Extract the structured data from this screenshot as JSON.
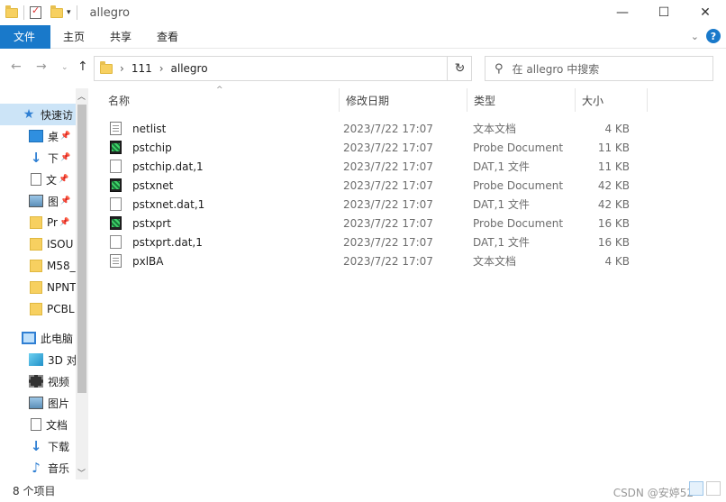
{
  "window": {
    "title": "allegro",
    "controls": {
      "minimize": "—",
      "maximize": "☐",
      "close": "✕"
    }
  },
  "ribbon": {
    "tabs": [
      "文件",
      "主页",
      "共享",
      "查看"
    ],
    "help": "?"
  },
  "address": {
    "crumbs": [
      "111",
      "allegro"
    ],
    "search_placeholder": "在 allegro 中搜索"
  },
  "sidebar": {
    "items": [
      {
        "label": "快速访",
        "icon": "star-icon",
        "pinned": false,
        "selected": true
      },
      {
        "label": "桌",
        "icon": "desktop-icon",
        "pinned": true
      },
      {
        "label": "下",
        "icon": "download-icon",
        "pinned": true
      },
      {
        "label": "文",
        "icon": "document-icon",
        "pinned": true
      },
      {
        "label": "图",
        "icon": "picture-icon",
        "pinned": true
      },
      {
        "label": "Pr",
        "icon": "folder-icon",
        "pinned": true
      },
      {
        "label": "ISOU",
        "icon": "folder-icon",
        "pinned": false
      },
      {
        "label": "M58_",
        "icon": "folder-icon",
        "pinned": false
      },
      {
        "label": "NPNT",
        "icon": "folder-icon",
        "pinned": false
      },
      {
        "label": "PCBL",
        "icon": "folder-icon",
        "pinned": false
      },
      {
        "label": "此电脑",
        "icon": "pc-icon",
        "pinned": false
      },
      {
        "label": "3D 对",
        "icon": "3d-objects-icon",
        "pinned": false
      },
      {
        "label": "视频",
        "icon": "video-icon",
        "pinned": false
      },
      {
        "label": "图片",
        "icon": "picture-icon",
        "pinned": false
      },
      {
        "label": "文档",
        "icon": "document-icon",
        "pinned": false
      },
      {
        "label": "下载",
        "icon": "download-icon",
        "pinned": false
      },
      {
        "label": "音乐",
        "icon": "music-icon",
        "pinned": false
      }
    ]
  },
  "columns": {
    "name": "名称",
    "date": "修改日期",
    "type": "类型",
    "size": "大小"
  },
  "files": [
    {
      "name": "netlist",
      "date": "2023/7/22 17:07",
      "type": "文本文档",
      "size": "4 KB",
      "icon": "text-file-icon"
    },
    {
      "name": "pstchip",
      "date": "2023/7/22 17:07",
      "type": "Probe Document",
      "size": "11 KB",
      "icon": "probe-file-icon"
    },
    {
      "name": "pstchip.dat,1",
      "date": "2023/7/22 17:07",
      "type": "DAT,1 文件",
      "size": "11 KB",
      "icon": "blank-file-icon"
    },
    {
      "name": "pstxnet",
      "date": "2023/7/22 17:07",
      "type": "Probe Document",
      "size": "42 KB",
      "icon": "probe-file-icon"
    },
    {
      "name": "pstxnet.dat,1",
      "date": "2023/7/22 17:07",
      "type": "DAT,1 文件",
      "size": "42 KB",
      "icon": "blank-file-icon"
    },
    {
      "name": "pstxprt",
      "date": "2023/7/22 17:07",
      "type": "Probe Document",
      "size": "16 KB",
      "icon": "probe-file-icon"
    },
    {
      "name": "pstxprt.dat,1",
      "date": "2023/7/22 17:07",
      "type": "DAT,1 文件",
      "size": "16 KB",
      "icon": "blank-file-icon"
    },
    {
      "name": "pxlBA",
      "date": "2023/7/22 17:07",
      "type": "文本文档",
      "size": "4 KB",
      "icon": "text-file-icon"
    }
  ],
  "status": {
    "count": "8 个项目",
    "watermark": "CSDN @安婷52"
  }
}
